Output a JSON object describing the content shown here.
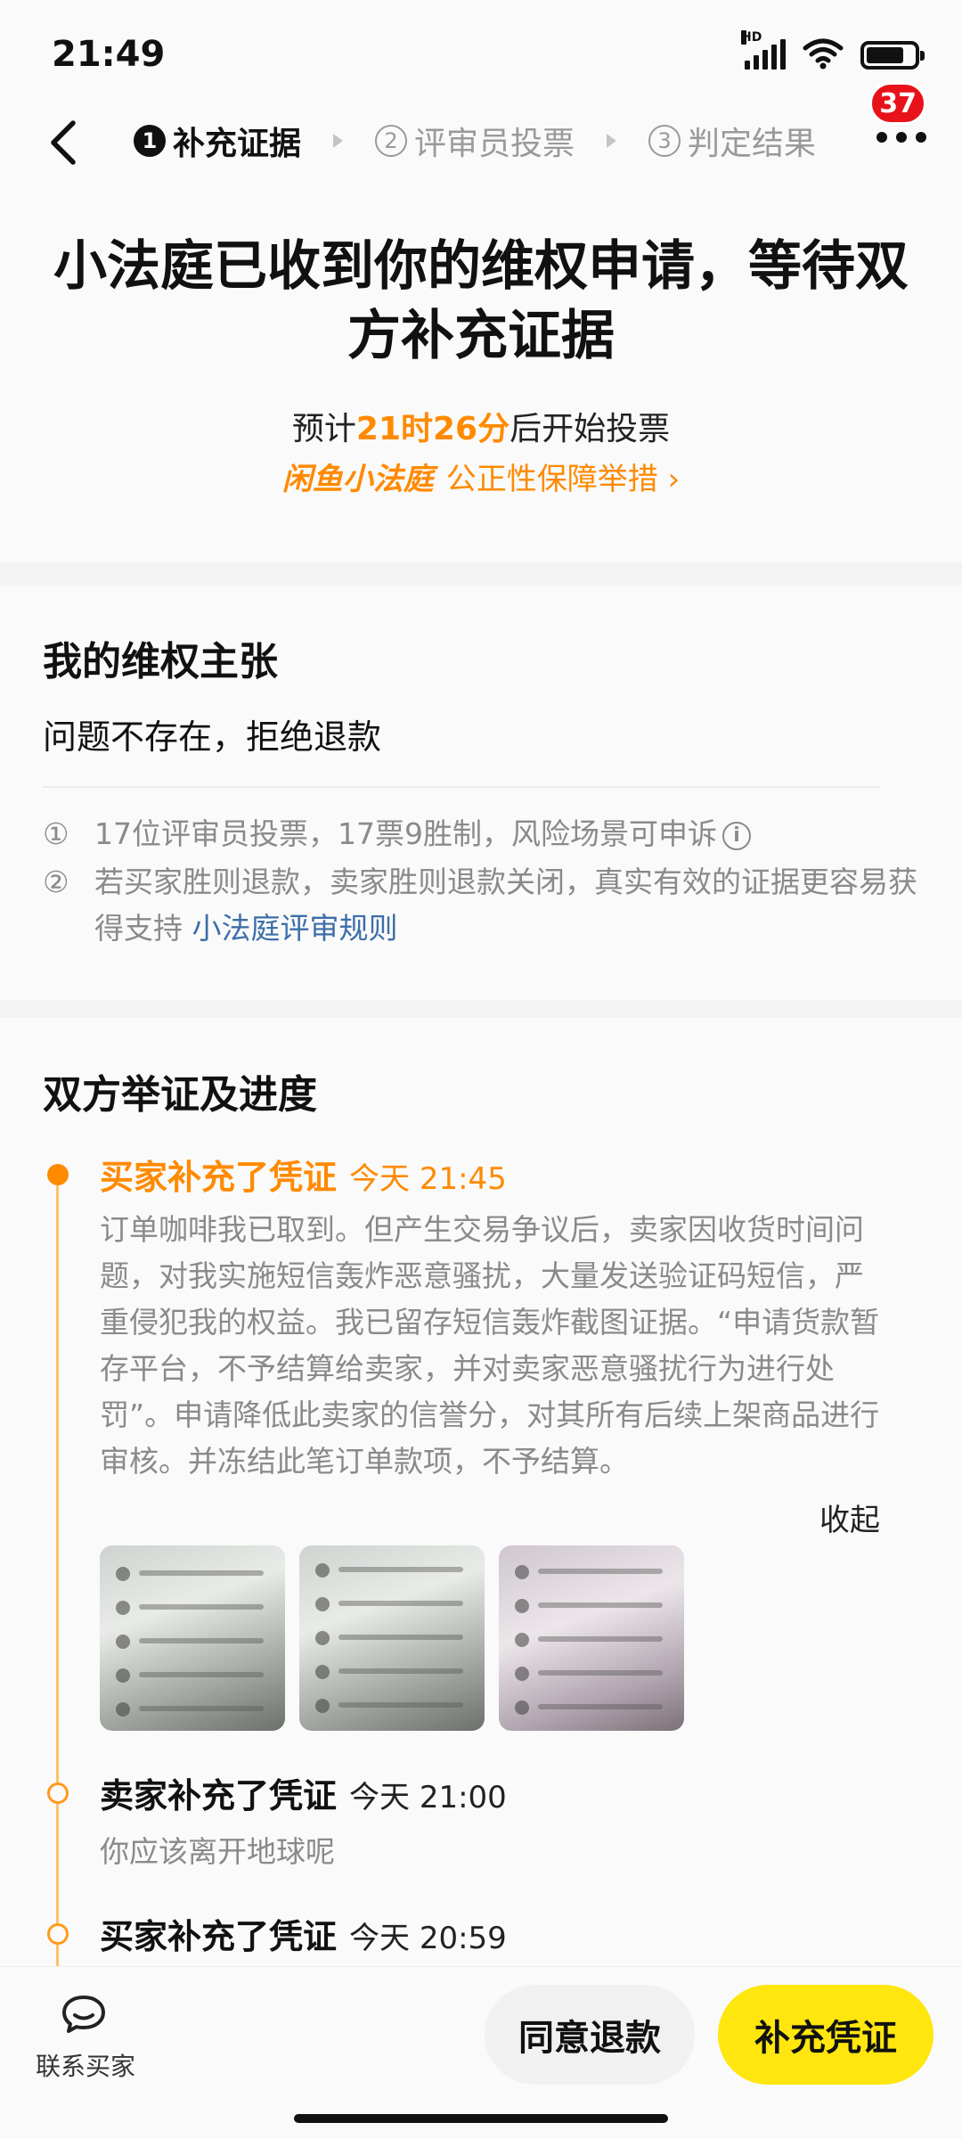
{
  "status_bar": {
    "time": "21:49",
    "network": "HD",
    "battery_level": 0.78
  },
  "nav": {
    "steps": [
      {
        "number": "1",
        "label": "补充证据",
        "active": true
      },
      {
        "number": "2",
        "label": "评审员投票",
        "active": false
      },
      {
        "number": "3",
        "label": "判定结果",
        "active": false
      }
    ],
    "badge_count": "37"
  },
  "hero": {
    "title": "小法庭已收到你的维权申请，等待双方补充证据",
    "countdown_prefix": "预计",
    "countdown_time": "21时26分",
    "countdown_suffix": "后开始投票",
    "brand": "闲鱼小法庭",
    "guarantee_link": "公正性保障举措 ›"
  },
  "claim": {
    "title": "我的维权主张",
    "value": "问题不存在，拒绝退款",
    "rules": [
      {
        "marker": "①",
        "text": "17位评审员投票，17票9胜制，风险场景可申诉"
      },
      {
        "marker": "②",
        "text": "若买家胜则退款，卖家胜则退款关闭，真实有效的证据更容易获得支持",
        "link": "小法庭评审规则"
      }
    ],
    "info_icon": "i"
  },
  "evidence": {
    "title": "双方举证及进度",
    "entries": [
      {
        "who": "买家补充了凭证",
        "time": "今天 21:45",
        "body": "订单咖啡我已取到。但产生交易争议后，卖家因收货时间问题，对我实施短信轰炸恶意骚扰，大量发送验证码短信，严重侵犯我的权益。我已留存短信轰炸截图证据。“申请货款暂存平台，不予结算给卖家，并对卖家恶意骚扰行为进行处罚”。申请降低此卖家的信誉分，对其所有后续上架商品进行审核。并冻结此笔订单款项，不予结算。",
        "collapse": "收起",
        "images": [
          "sms-screenshot-1",
          "sms-screenshot-2",
          "sms-screenshot-3"
        ]
      },
      {
        "who": "卖家补充了凭证",
        "time": "今天 21:00",
        "body": "你应该离开地球呢"
      },
      {
        "who": "买家补充了凭证",
        "time": "今天 20:59"
      }
    ]
  },
  "bottom": {
    "contact_label": "联系买家",
    "agree_button": "同意退款",
    "supply_button": "补充凭证"
  },
  "colors": {
    "accent": "#ff8a00",
    "primary_button": "#ffe60f",
    "badge": "#e8121a",
    "link": "#3d6ea9"
  }
}
